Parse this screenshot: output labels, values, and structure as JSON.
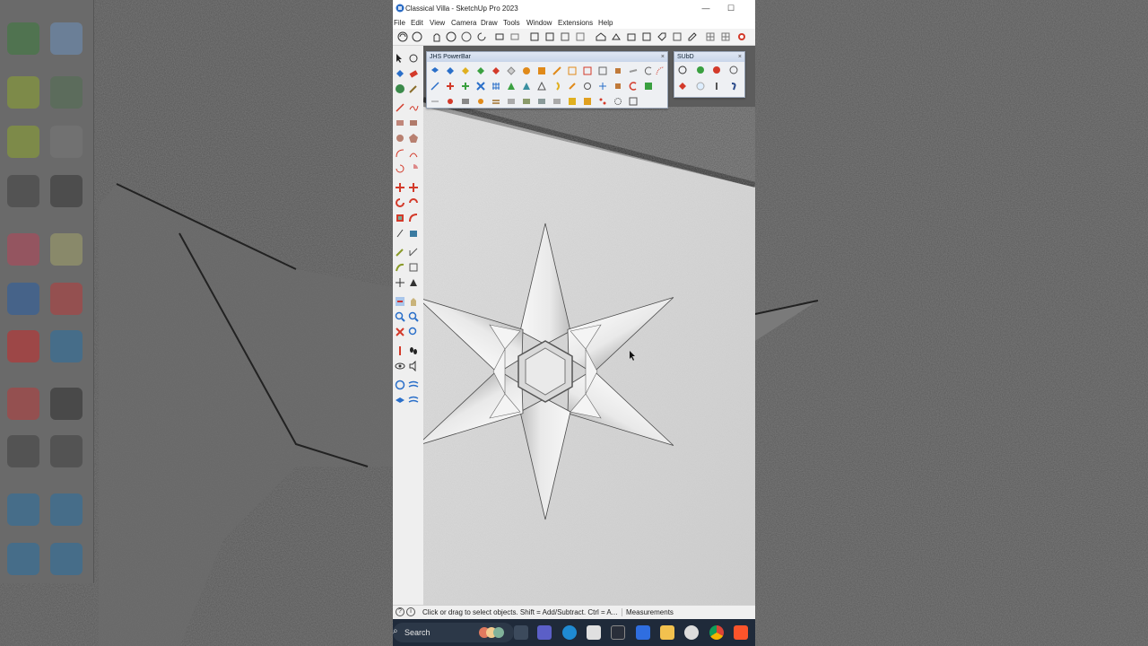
{
  "window": {
    "title": "Classical Villa - SketchUp Pro 2023",
    "minimize_glyph": "—",
    "maximize_glyph": "☐"
  },
  "menu": [
    "File",
    "Edit",
    "View",
    "Camera",
    "Draw",
    "Tools",
    "Window",
    "Extensions",
    "Help"
  ],
  "palettes": {
    "jhs": {
      "title": "JHS PowerBar",
      "close": "×"
    },
    "subd": {
      "title": "SUbD",
      "close": "×"
    }
  },
  "statusbar": {
    "hint": "Click or drag to select objects. Shift = Add/Subtract. Ctrl = A...",
    "measurements_label": "Measurements",
    "info_glyph": "i",
    "help_glyph": "?"
  },
  "taskbar": {
    "search_label": "Search",
    "search_icon": "search-icon",
    "apps": [
      "task-view-icon",
      "teams-icon",
      "edge-icon",
      "store-icon",
      "sketchup-icon",
      "visual-studio-icon",
      "file-explorer-icon",
      "obs-icon",
      "chrome-icon",
      "brave-icon"
    ]
  },
  "colors": {
    "accent": "#1f2a3a",
    "red_tool": "#d33a2a",
    "blue_tool": "#2a6fc9",
    "orange_tool": "#e08a1a"
  }
}
